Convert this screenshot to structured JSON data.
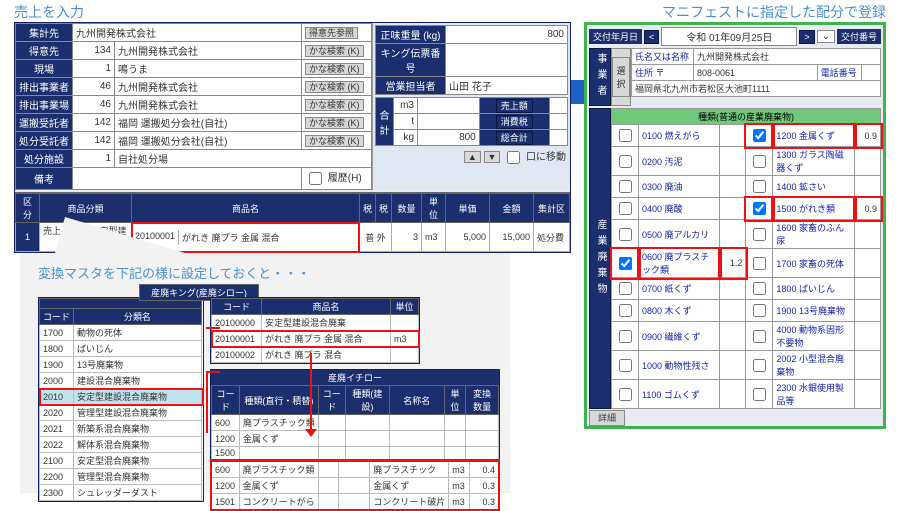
{
  "captions": {
    "sales": "売上を入力",
    "manifest": "マニフェストに指定した配分で登録",
    "callout": "変換マスタを下記の様に設定しておくと・・・"
  },
  "sales": {
    "labels": {
      "syukei": "集計先",
      "tokuisaki": "得意先",
      "genba": "現場",
      "haishutsu_jigyo": "排出事業者",
      "haishutsu_jigyoba": "排出事業場",
      "unpan": "運搬受託者",
      "shobun": "処分受託者",
      "shisetsu": "処分施設",
      "biko": "備考",
      "tokuisaki_ref": "得意先参照",
      "seimi": "正味重量 (kg)",
      "king_denpyo": "キング伝票番号",
      "eigyo": "営業担当者",
      "uriage": "売上額",
      "shohi": "消費税",
      "gokei": "総合計",
      "rireki": "履歴(H)",
      "jiki_ido": "口に移動",
      "kana": "かな検索 (K)"
    },
    "vals": {
      "syukei": "九州開発株式会社",
      "tokuisaki_cd": "134",
      "tokuisaki_nm": "九州開発株式会社",
      "genba_cd": "1",
      "genba_nm": "鳴うま",
      "haishutsu_jigyo_cd": "46",
      "haishutsu_jigyo_nm": "九州開発株式会社",
      "haishutsu_jigyoba_cd": "46",
      "haishutsu_jigyoba_nm": "九州開発株式会社",
      "unpan_cd": "142",
      "unpan_nm": "福岡 運搬処分会社(自社)",
      "shobun_cd": "142",
      "shobun_nm": "福岡 運搬処分会社(自社)",
      "shisetsu_cd": "1",
      "shisetsu_nm": "自社処分場",
      "seimi": "800",
      "eigyo": "山田 花子",
      "unit1": "m3",
      "unit2": "t",
      "unit3": "kg",
      "t_val": "800"
    },
    "detail": {
      "headers": [
        "区分",
        "商品分類",
        "商品名",
        "税",
        "数量",
        "単位",
        "単価",
        "金額",
        "集計区"
      ],
      "row": {
        "kubun": "売上",
        "bunrui": "2010 安定型建設混…",
        "hinmei_cd": "20100001",
        "hinmei_nm": "がれき 廃プラ 金属 混合",
        "zei": "普 外",
        "qty": "3",
        "unit": "m3",
        "tanka": "5,000",
        "kingaku": "15,000",
        "syukei": "処分費"
      },
      "gokei_row": {
        "lbl": "合計",
        "val": ""
      }
    }
  },
  "callout": {
    "king_title": "産廃キング(産廃シロー)",
    "left_headers": [
      "コード",
      "分類名"
    ],
    "left_rows": [
      [
        "1700",
        "動物の死体"
      ],
      [
        "1800",
        "ばいじん"
      ],
      [
        "1900",
        "13号廃棄物"
      ],
      [
        "2000",
        "建設混合廃棄物"
      ],
      [
        "2010",
        "安定型建設混合廃棄物"
      ],
      [
        "2020",
        "管理型建設混合廃棄物"
      ],
      [
        "2021",
        "新築系混合廃棄物"
      ],
      [
        "2022",
        "解体系混合廃棄物"
      ],
      [
        "2100",
        "安定型混合廃棄物"
      ],
      [
        "2200",
        "管理型混合廃棄物"
      ],
      [
        "2300",
        "シュレッダーダスト"
      ]
    ],
    "right_headers": [
      "コード",
      "商品名",
      "単位"
    ],
    "right_rows": [
      [
        "20100000",
        "安定型建設混合廃棄",
        ""
      ],
      [
        "20100001",
        "がれき 廃プラ 金属 混合",
        "m3"
      ],
      [
        "20100002",
        "がれき 廃プラ 混合",
        ""
      ]
    ],
    "ichiro_title": "産廃イチロー",
    "ichiro_headers": [
      "コード",
      "種類(直行・積替)",
      "コード",
      "種類(建設)",
      "コード",
      "名称名",
      "単位",
      "変換数量"
    ],
    "ichiro_rows_left": [
      [
        "600",
        "廃プラスチック類"
      ],
      [
        "1200",
        "金属くず"
      ],
      [
        "1500",
        ""
      ]
    ],
    "ichiro_rows_right": [
      [
        "600",
        "廃プラスチック類",
        "",
        "",
        "廃プラスチック",
        "m3",
        "0.4"
      ],
      [
        "1200",
        "金属くず",
        "",
        "",
        "金属くず",
        "m3",
        "0.3"
      ],
      [
        "1501",
        "コンクリートがら",
        "",
        "",
        "コンクリート破片",
        "m3",
        "0.3"
      ]
    ]
  },
  "manifest": {
    "top": {
      "label_date": "交付年月日",
      "date": "令和 01年09月25日",
      "label_no": "交付番号",
      "sel_btn": "選択",
      "detail_btn": "詳細"
    },
    "biz": {
      "side": "事業者",
      "name_lbl": "氏名又は名称",
      "name": "九州開発株式会社",
      "addr_lbl": "住所 〒",
      "zip": "808-0061",
      "tel_lbl": "電話番号",
      "addr": "福岡県北九州市若松区大池町1111"
    },
    "waste_side": "産業廃棄物",
    "waste_header": "種類(普通の産業廃棄物)",
    "rows_left": [
      {
        "code": "0100",
        "name": "燃えがら",
        "chk": false,
        "val": ""
      },
      {
        "code": "0200",
        "name": "汚泥",
        "chk": false,
        "val": ""
      },
      {
        "code": "0300",
        "name": "廃油",
        "chk": false,
        "val": ""
      },
      {
        "code": "0400",
        "name": "廃酸",
        "chk": false,
        "val": ""
      },
      {
        "code": "0500",
        "name": "廃アルカリ",
        "chk": false,
        "val": ""
      },
      {
        "code": "0600",
        "name": "廃プラスチック類",
        "chk": true,
        "val": "1.2",
        "hl": true
      },
      {
        "code": "0700",
        "name": "紙くず",
        "chk": false,
        "val": ""
      },
      {
        "code": "0800",
        "name": "木くず",
        "chk": false,
        "val": ""
      },
      {
        "code": "0900",
        "name": "繊維くず",
        "chk": false,
        "val": ""
      },
      {
        "code": "1000",
        "name": "動物性残さ",
        "chk": false,
        "val": ""
      },
      {
        "code": "1100",
        "name": "ゴムくず",
        "chk": false,
        "val": ""
      }
    ],
    "rows_right": [
      {
        "code": "1200",
        "name": "金属くず",
        "chk": true,
        "val": "0.9",
        "hl": true
      },
      {
        "code": "1300",
        "name": "ガラス陶磁器くず",
        "chk": false,
        "val": ""
      },
      {
        "code": "1400",
        "name": "鉱さい",
        "chk": false,
        "val": ""
      },
      {
        "code": "1500",
        "name": "がれき類",
        "chk": true,
        "val": "0.9",
        "hl": true
      },
      {
        "code": "1600",
        "name": "家畜のふん尿",
        "chk": false,
        "val": ""
      },
      {
        "code": "1700",
        "name": "家畜の死体",
        "chk": false,
        "val": ""
      },
      {
        "code": "1800",
        "name": "ばいじん",
        "chk": false,
        "val": ""
      },
      {
        "code": "1900",
        "name": "13号廃棄物",
        "chk": false,
        "val": ""
      },
      {
        "code": "4000",
        "name": "動物系固形不要物",
        "chk": false,
        "val": ""
      },
      {
        "code": "2002",
        "name": "小型混合廃棄物",
        "chk": false,
        "val": ""
      },
      {
        "code": "2300",
        "name": "水銀使用製品等",
        "chk": false,
        "val": ""
      }
    ]
  }
}
